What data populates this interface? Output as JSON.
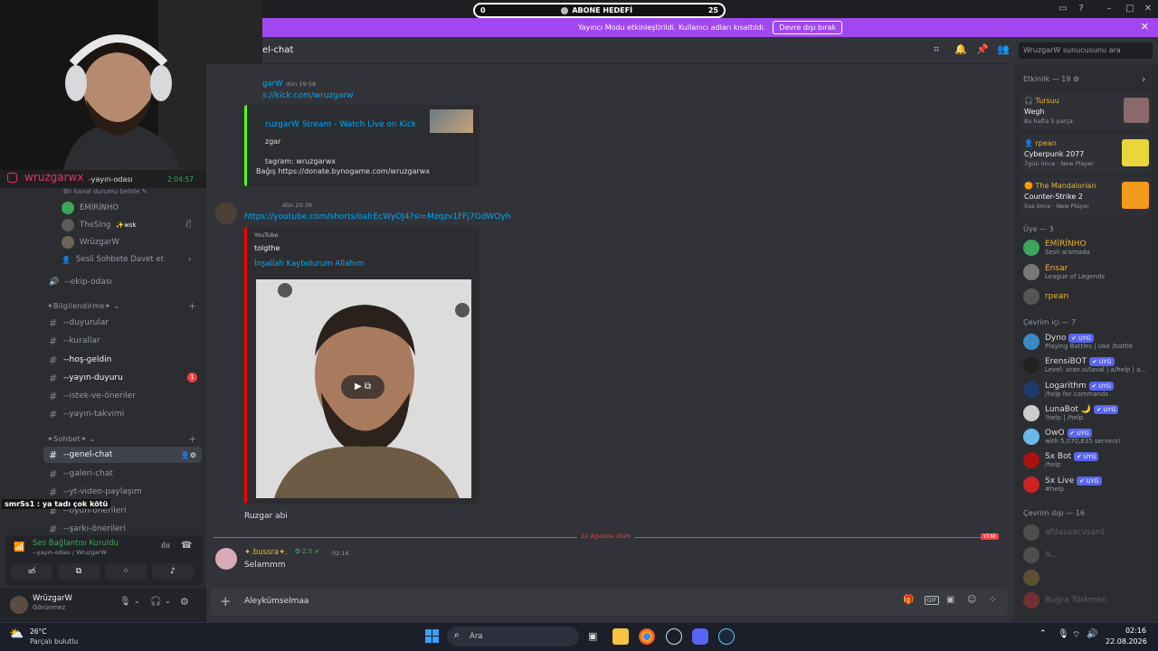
{
  "stream": {
    "goal_label": "ABONE HEDEFİ",
    "goal_min": "0",
    "goal_max": "25",
    "streamer": "wruzgarwx",
    "timer": "2:04:57",
    "chat_overlay": "smrSs1 : ya tadı çok kötü"
  },
  "banner": {
    "text": "Yayıncı Modu etkinleştirildi. Kullanıcı adları kısaltıldı.",
    "button": "Devre dışı bırak"
  },
  "header": {
    "channel": "el-chat",
    "search_placeholder": "WruzgarW sunucusunu ara"
  },
  "sidebar": {
    "voice_channel": "-yayın-odası",
    "voice_status": "Bir kanal durumu belirle",
    "voice_users": [
      "EMİRİNHO",
      "TheSing",
      "WrüzgarW"
    ],
    "thesing_badge": "wsk",
    "voice_invite": "Sesli Sohbete Davet et",
    "ekip": "--ekip-odası",
    "cat1": "Bilgilendirme",
    "info_channels": [
      "--duyurular",
      "--kurallar",
      "--hoş-geldin",
      "--yayın-duyuru",
      "--istek-ve-öneriler",
      "--yayın-takvimi"
    ],
    "yayin_duyuru_badge": "1",
    "cat2": "Sohbet",
    "chat_channels": [
      "--genel-chat",
      "--galeri-chat",
      "--yt-video-paylaşım",
      "--oyun-önerileri",
      "--şarkı-önerileri"
    ],
    "voice_connected": "Ses Bağlantısı Kuruldu",
    "voice_connected_sub": "--yayın-odası / WruzgarW",
    "user": "WrüzgarW",
    "user_status": "Görünmez"
  },
  "messages": {
    "m1_author": "garW",
    "m1_time": "dün 19:58",
    "m1_link": "s://kick.com/wruzgarw",
    "m1_embed_title": "ruzgarW Stream - Watch Live on Kick",
    "m1_embed_line1": "zgar",
    "m1_embed_line2": "tagram: wruzgarwx",
    "m1_embed_line3": "Bağış https://donate.bynogame.com/wruzgarwx",
    "m2_time": "dün 20:36",
    "m2_link": "https://youtube.com/shorts/oalrEcWyOJ4?si=Mzqzv1FFj7GdWOyh",
    "m2_embed_provider": "YouTube",
    "m2_embed_author": "tolgthe",
    "m2_embed_title": "İnşallah Kaybolurum Allahım",
    "m2_text": "Ruzgar abi",
    "divider_date": "22 Ağustos 2026",
    "divider_new": "YENİ",
    "m3_author": "bussra",
    "m3_tag": "Z.E",
    "m3_time": "02:16",
    "m3_text": "Selammm"
  },
  "input": {
    "value": "Aleykümselmaa"
  },
  "members": {
    "activity_title": "Etkinlik — 19",
    "activities": [
      {
        "user": "Tursuu",
        "game": "Wegh",
        "sub": "Bu hafta 5 parça"
      },
      {
        "user": "rpean",
        "game": "Cyberpunk 2077",
        "sub": "7gün önce · New Player"
      },
      {
        "user": "The Mandalorian",
        "game": "Counter-Strike 2",
        "sub": "5sa önce · New Player"
      }
    ],
    "owner_title": "Üye — 3",
    "owners": [
      {
        "name": "EMİRİNHO",
        "sub": "Sesli aramada",
        "color": "#3ba55d"
      },
      {
        "name": "Ensar",
        "sub": "League of Legends",
        "color": "#f0b232"
      },
      {
        "name": "rpean",
        "sub": "",
        "color": "#f0b232"
      }
    ],
    "online_title": "Çevrim içi — 7",
    "online": [
      {
        "name": "Dyno",
        "sub": "Playing Battles | Use /battle"
      },
      {
        "name": "ErensiBOT",
        "sub": "Level: aran.si/laval | a/help | a..."
      },
      {
        "name": "Logarithm",
        "sub": "/help for commands"
      },
      {
        "name": "LunaBot",
        "sub": "!help | /help"
      },
      {
        "name": "OwO",
        "sub": "with 5,070,635 servers!"
      },
      {
        "name": "Sx Bot",
        "sub": "/help"
      },
      {
        "name": "Sx Live",
        "sub": "#help"
      }
    ],
    "bot_badge": "UYG",
    "offline_title": "Çevrim dışı — 16",
    "offline": [
      "afdasaacvsard",
      "A...",
      "Buğra Törkmen"
    ]
  },
  "taskbar": {
    "weather_temp": "26°C",
    "weather_desc": "Parçalı bulutlu",
    "search": "Ara",
    "time": "02:16",
    "date": "22.08.2026"
  },
  "colors": {
    "accent": "#5865f2",
    "banner": "#a147ef",
    "link": "#00a8fc"
  }
}
